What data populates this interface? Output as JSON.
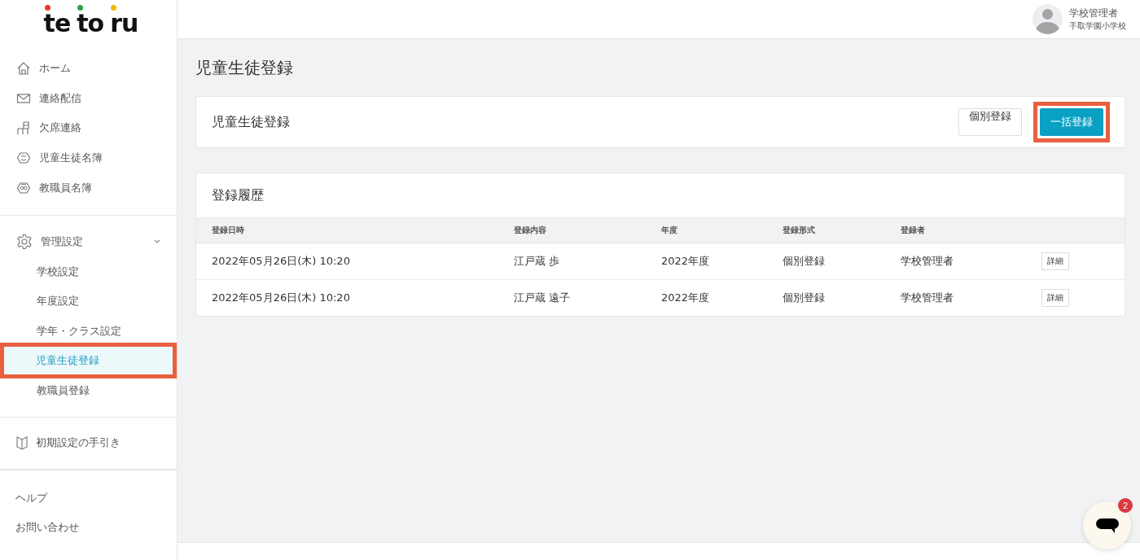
{
  "logo": {
    "parts": [
      {
        "text": "te",
        "color": "#e8372c"
      },
      {
        "text": "to",
        "color": "#2aa44a"
      },
      {
        "text": "ru",
        "color": "#f5b800"
      }
    ]
  },
  "sidebar": {
    "main_items": [
      {
        "label": "ホーム"
      },
      {
        "label": "連絡配信"
      },
      {
        "label": "欠席連絡"
      },
      {
        "label": "児童生徒名簿"
      },
      {
        "label": "教職員名簿"
      }
    ],
    "settings": {
      "label": "管理設定",
      "expanded": true,
      "children": [
        {
          "label": "学校設定",
          "selected": false,
          "highlighted": false
        },
        {
          "label": "年度設定",
          "selected": false,
          "highlighted": false
        },
        {
          "label": "学年・クラス設定",
          "selected": false,
          "highlighted": false
        },
        {
          "label": "児童生徒登録",
          "selected": true,
          "highlighted": true
        },
        {
          "label": "教職員登録",
          "selected": false,
          "highlighted": false
        }
      ]
    },
    "guide": {
      "label": "初期設定の手引き"
    },
    "footer_links": [
      "ヘルプ",
      "お問い合わせ"
    ]
  },
  "user": {
    "name": "学校管理者",
    "school": "手取学園小学校"
  },
  "page_title": "児童生徒登録",
  "action_card": {
    "title": "児童生徒登録",
    "buttons": [
      {
        "label": "個別登録",
        "kind": "secondary",
        "highlighted": false
      },
      {
        "label": "一括登録",
        "kind": "primary",
        "highlighted": true
      }
    ]
  },
  "history": {
    "title": "登録履歴",
    "columns": [
      "登録日時",
      "登録内容",
      "年度",
      "登録形式",
      "登録者"
    ],
    "rows": [
      {
        "cells": [
          "2022年05月26日(木) 10:20",
          "江戸蔵 歩",
          "2022年度",
          "個別登録",
          "学校管理者"
        ],
        "action": "詳細"
      },
      {
        "cells": [
          "2022年05月26日(木) 10:20",
          "江戸蔵 遠子",
          "2022年度",
          "個別登録",
          "学校管理者"
        ],
        "action": "詳細"
      }
    ]
  },
  "chat": {
    "badge": "2"
  }
}
